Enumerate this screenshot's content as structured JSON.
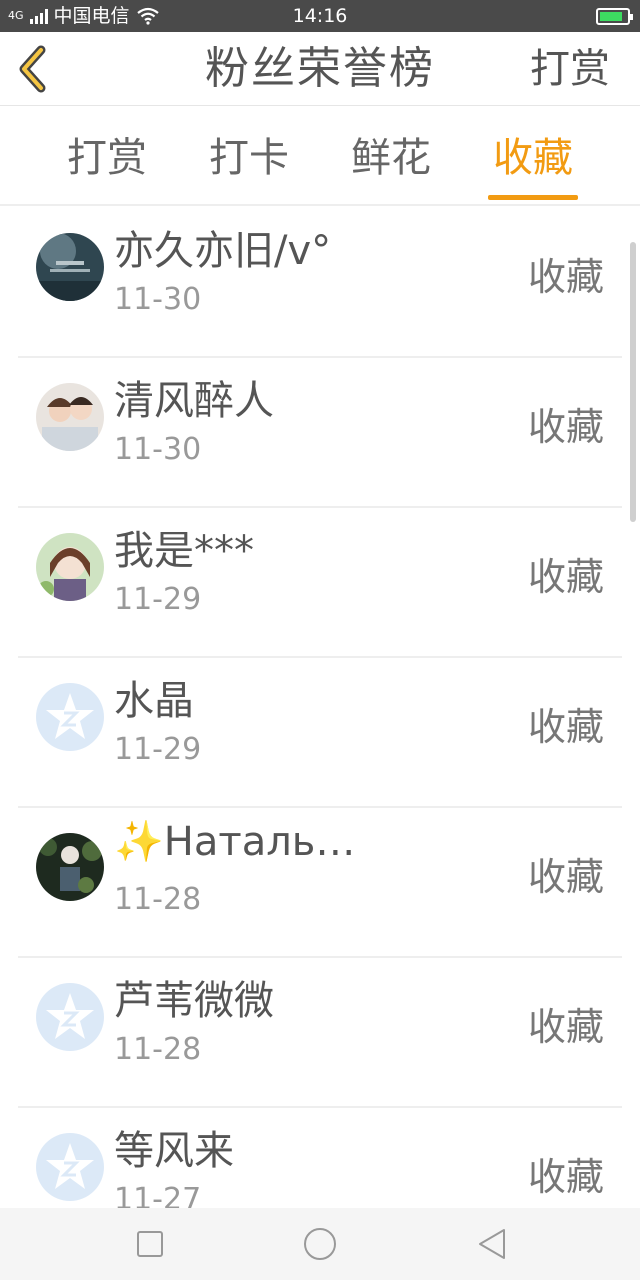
{
  "status_bar": {
    "network": "4G",
    "carrier": "中国电信",
    "time": "14:16",
    "icons": [
      "signal-icon",
      "wifi-icon",
      "battery-charging-icon"
    ]
  },
  "header": {
    "title": "粉丝荣誉榜",
    "action_label": "打赏",
    "back_icon": "chevron-left-icon"
  },
  "tabs": [
    {
      "label": "打赏",
      "active": false
    },
    {
      "label": "打卡",
      "active": false
    },
    {
      "label": "鲜花",
      "active": false
    },
    {
      "label": "收藏",
      "active": true
    }
  ],
  "fans": [
    {
      "name": "亦久亦旧/v°",
      "date": "11-30",
      "action": "收藏",
      "avatar": "dark-photo-avatar"
    },
    {
      "name": "清风醉人",
      "date": "11-30",
      "action": "收藏",
      "avatar": "couple-photo-avatar"
    },
    {
      "name": "我是***",
      "date": "11-29",
      "action": "收藏",
      "avatar": "anime-girl-avatar"
    },
    {
      "name": "水晶",
      "date": "11-29",
      "action": "收藏",
      "avatar": "default-star-avatar"
    },
    {
      "name": "✨Наталь…",
      "date": "11-28",
      "action": "收藏",
      "avatar": "flower-photo-avatar"
    },
    {
      "name": "芦苇微微",
      "date": "11-28",
      "action": "收藏",
      "avatar": "default-star-avatar"
    },
    {
      "name": "等风来",
      "date": "11-27",
      "action": "收藏",
      "avatar": "default-star-avatar"
    }
  ],
  "colors": {
    "accent": "#f29b12",
    "text": "#555555",
    "subtext": "#999999",
    "default_avatar": "#dce9f7"
  },
  "nav_bar": {
    "icons": [
      "square-recents-icon",
      "circle-home-icon",
      "triangle-back-icon"
    ]
  }
}
